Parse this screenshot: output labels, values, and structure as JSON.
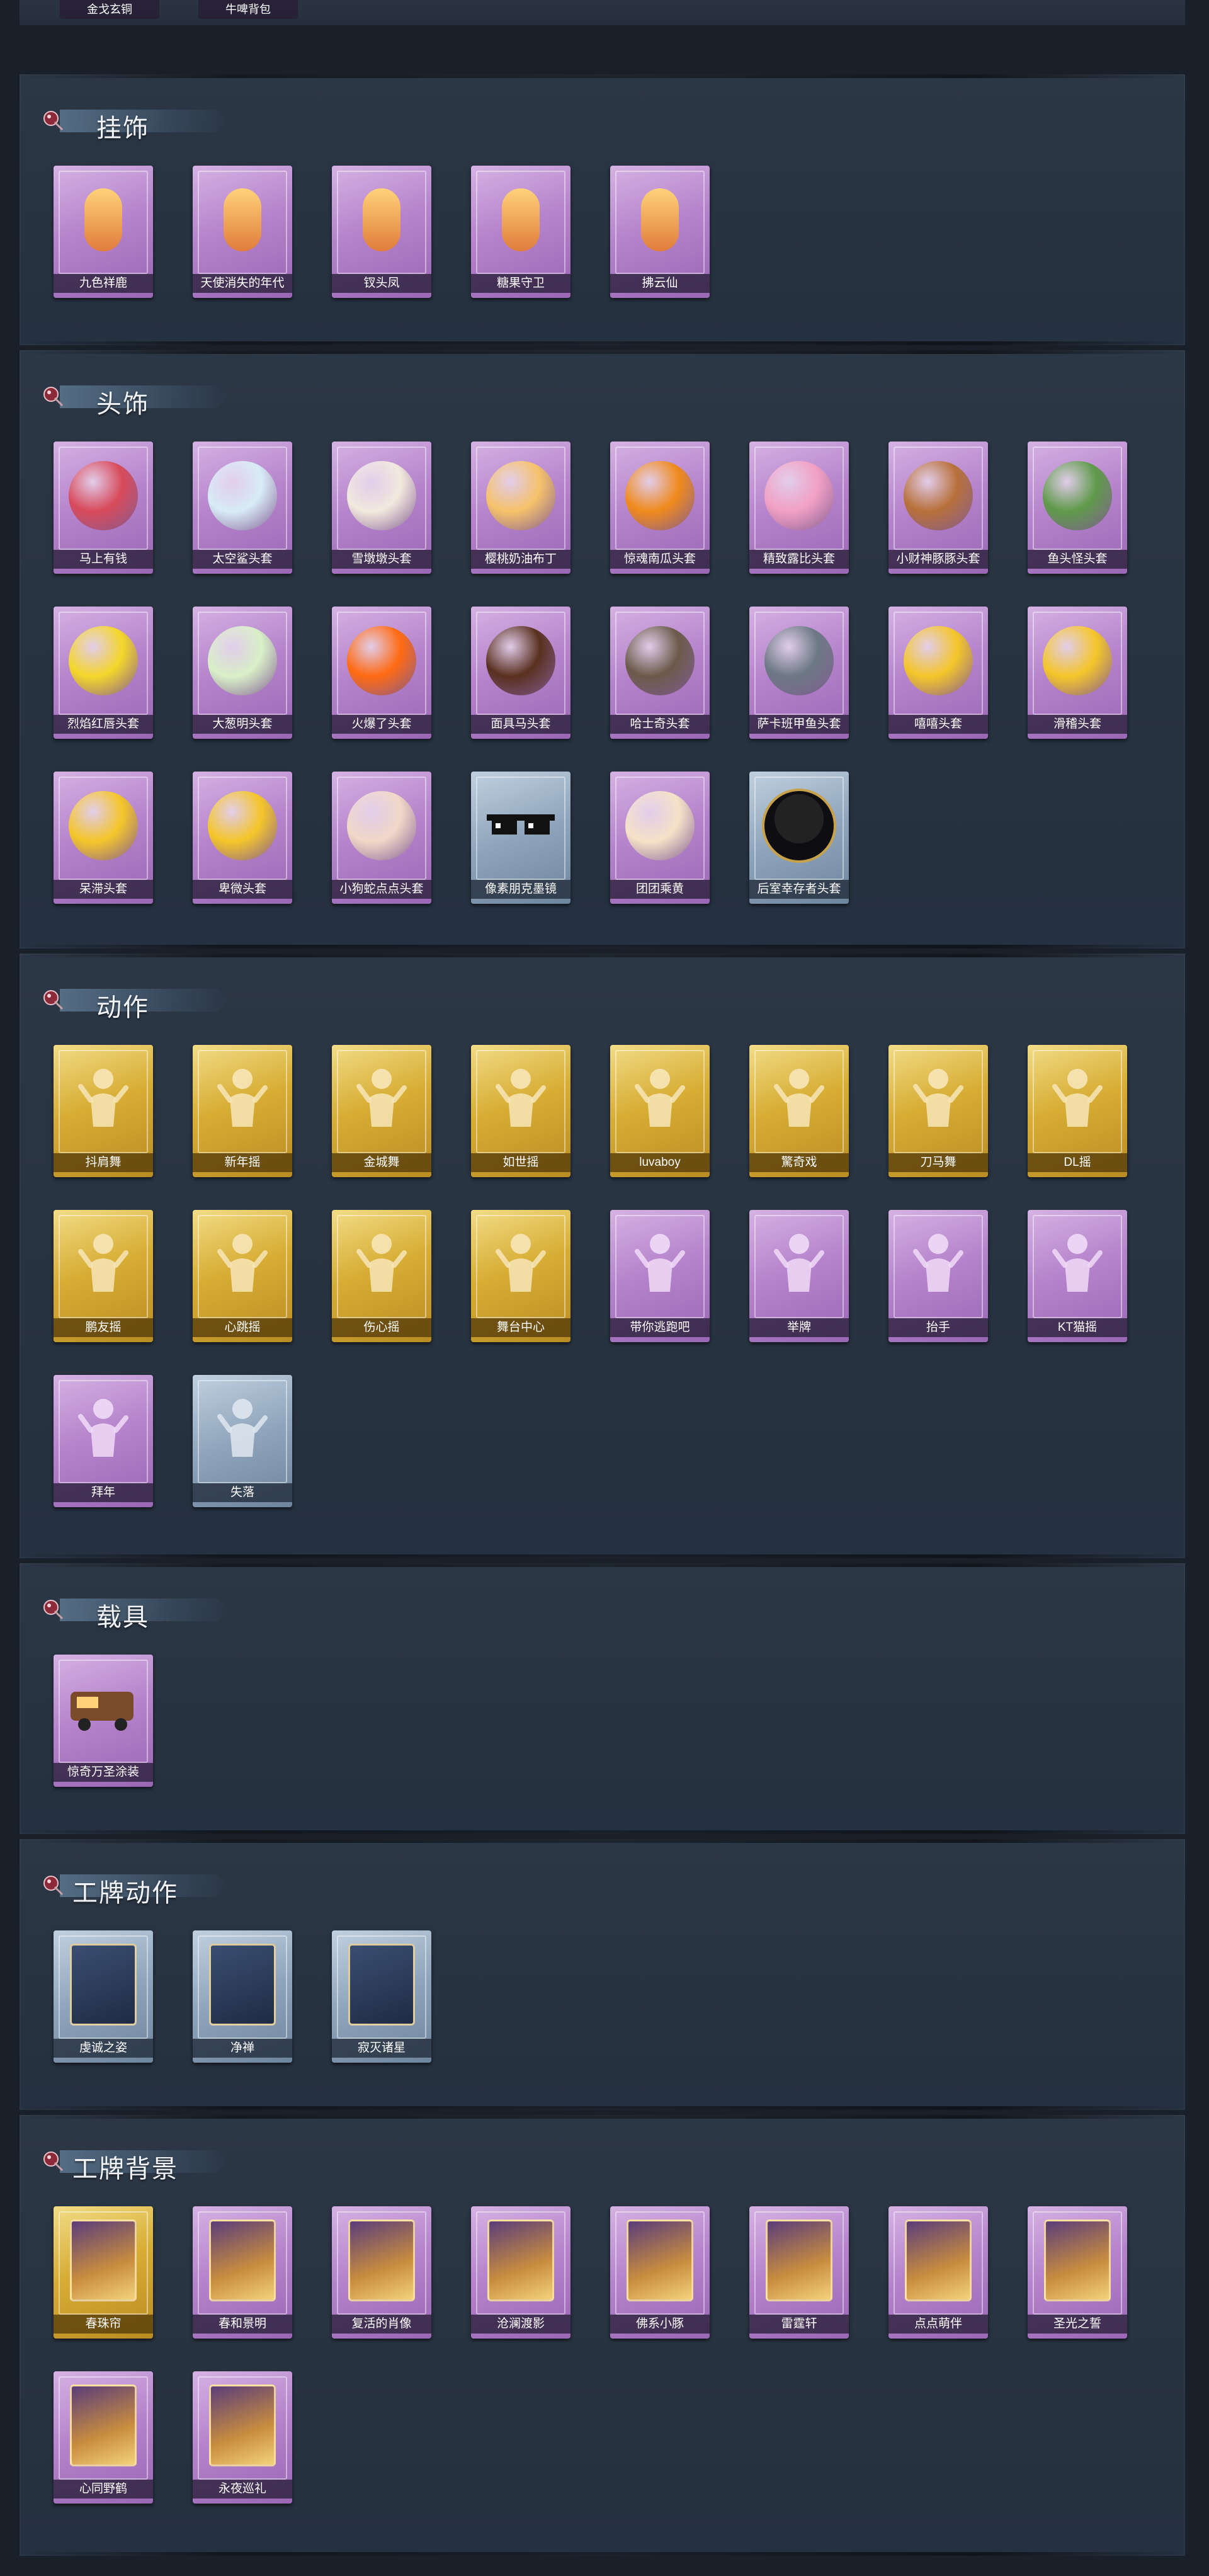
{
  "top": {
    "items": [
      "金戈玄铜",
      "牛啤背包"
    ]
  },
  "sections": [
    {
      "title": "挂饰",
      "items": [
        {
          "label": "九色祥鹿",
          "color": "purple",
          "icon": "pendant-deer-icon"
        },
        {
          "label": "天使消失的年代",
          "color": "purple",
          "icon": "pendant-angel-icon"
        },
        {
          "label": "钗头凤",
          "color": "purple",
          "icon": "pendant-phoenix-icon"
        },
        {
          "label": "糖果守卫",
          "color": "purple",
          "icon": "pendant-candy-icon"
        },
        {
          "label": "拂云仙",
          "color": "purple",
          "icon": "pendant-cloud-icon"
        }
      ]
    },
    {
      "title": "头饰",
      "items": [
        {
          "label": "马上有钱",
          "color": "purple",
          "icon": "horse-head-icon"
        },
        {
          "label": "太空鲨头套",
          "color": "purple",
          "icon": "shark-head-icon"
        },
        {
          "label": "雪墩墩头套",
          "color": "purple",
          "icon": "snow-dumpling-icon"
        },
        {
          "label": "樱桃奶油布丁",
          "color": "purple",
          "icon": "pudding-icon"
        },
        {
          "label": "惊魂南瓜头套",
          "color": "purple",
          "icon": "pumpkin-icon"
        },
        {
          "label": "精致露比头套",
          "color": "purple",
          "icon": "pink-creature-icon"
        },
        {
          "label": "小财神豚豚头套",
          "color": "purple",
          "icon": "piglet-icon"
        },
        {
          "label": "鱼头怪头套",
          "color": "purple",
          "icon": "fish-head-icon"
        },
        {
          "label": "烈焰红唇头套",
          "color": "purple",
          "icon": "pikachu-icon"
        },
        {
          "label": "大葱明头套",
          "color": "purple",
          "icon": "scallion-icon"
        },
        {
          "label": "火爆了头套",
          "color": "purple",
          "icon": "flame-icon"
        },
        {
          "label": "面具马头套",
          "color": "purple",
          "icon": "horse-mask-icon"
        },
        {
          "label": "哈士奇头套",
          "color": "purple",
          "icon": "husky-icon"
        },
        {
          "label": "萨卡班甲鱼头套",
          "color": "purple",
          "icon": "fish-icon"
        },
        {
          "label": "嘻嘻头套",
          "color": "purple",
          "icon": "grin-emoji-icon"
        },
        {
          "label": "滑稽头套",
          "color": "purple",
          "icon": "smirk-emoji-icon"
        },
        {
          "label": "呆滞头套",
          "color": "purple",
          "icon": "dazed-emoji-icon"
        },
        {
          "label": "卑微头套",
          "color": "purple",
          "icon": "humble-emoji-icon"
        },
        {
          "label": "小狗蛇点点头套",
          "color": "purple",
          "icon": "snake-icon"
        },
        {
          "label": "像素朋克墨镜",
          "color": "blue",
          "icon": "pixel-sunglasses-icon"
        },
        {
          "label": "团团乘黄",
          "color": "purple",
          "icon": "cat-icon"
        },
        {
          "label": "后室幸存者头套",
          "color": "blue",
          "icon": "gas-mask-icon"
        }
      ]
    },
    {
      "title": "动作",
      "items": [
        {
          "label": "抖肩舞",
          "color": "gold",
          "icon": "dance-figure-icon"
        },
        {
          "label": "新年摇",
          "color": "gold",
          "icon": "dance-figure-icon"
        },
        {
          "label": "金城舞",
          "color": "gold",
          "icon": "dance-figure-icon"
        },
        {
          "label": "如世摇",
          "color": "gold",
          "icon": "dance-figure-icon"
        },
        {
          "label": "luvaboy",
          "color": "gold",
          "icon": "dance-figure-icon"
        },
        {
          "label": "驚奇戏",
          "color": "gold",
          "icon": "dance-figure-icon"
        },
        {
          "label": "刀马舞",
          "color": "gold",
          "icon": "dance-figure-icon"
        },
        {
          "label": "DL摇",
          "color": "gold",
          "icon": "dance-figure-icon"
        },
        {
          "label": "鹏友摇",
          "color": "gold",
          "icon": "dance-figure-icon"
        },
        {
          "label": "心跳摇",
          "color": "gold",
          "icon": "dance-figure-icon"
        },
        {
          "label": "伤心摇",
          "color": "gold",
          "icon": "dance-figure-icon"
        },
        {
          "label": "舞台中心",
          "color": "gold",
          "icon": "dance-figure-icon"
        },
        {
          "label": "带你逃跑吧",
          "color": "purple",
          "icon": "dance-figure-icon"
        },
        {
          "label": "举牌",
          "color": "purple",
          "icon": "sign-figure-icon"
        },
        {
          "label": "抬手",
          "color": "purple",
          "icon": "raise-hand-icon"
        },
        {
          "label": "KT猫摇",
          "color": "purple",
          "icon": "dance-figure-icon"
        },
        {
          "label": "拜年",
          "color": "purple",
          "icon": "bow-figure-icon"
        },
        {
          "label": "失落",
          "color": "blue",
          "icon": "crawl-figure-icon"
        }
      ]
    },
    {
      "title": "载具",
      "items": [
        {
          "label": "惊奇万圣涂装",
          "color": "purple",
          "icon": "vehicle-icon"
        }
      ]
    },
    {
      "title": "工牌动作",
      "items": [
        {
          "label": "虔诚之姿",
          "color": "blue",
          "icon": "badge-pose-icon"
        },
        {
          "label": "净禅",
          "color": "blue",
          "icon": "badge-pose-icon"
        },
        {
          "label": "寂灭诸星",
          "color": "blue",
          "icon": "badge-pose-icon"
        }
      ]
    },
    {
      "title": "工牌背景",
      "items": [
        {
          "label": "春珠帘",
          "color": "gold",
          "icon": "card-bg-icon"
        },
        {
          "label": "春和景明",
          "color": "purple",
          "icon": "card-bg-icon"
        },
        {
          "label": "复活的肖像",
          "color": "purple",
          "icon": "card-bg-icon"
        },
        {
          "label": "沧澜渡影",
          "color": "purple",
          "icon": "card-bg-icon"
        },
        {
          "label": "佛系小豚",
          "color": "purple",
          "icon": "card-bg-icon"
        },
        {
          "label": "雷霆轩",
          "color": "purple",
          "icon": "card-bg-icon"
        },
        {
          "label": "点点萌伴",
          "color": "purple",
          "icon": "card-bg-icon"
        },
        {
          "label": "圣光之誓",
          "color": "purple",
          "icon": "card-bg-icon"
        },
        {
          "label": "心同野鹤",
          "color": "purple",
          "icon": "card-bg-icon"
        },
        {
          "label": "永夜巡礼",
          "color": "purple",
          "icon": "card-bg-icon"
        }
      ]
    }
  ],
  "colors": {
    "purple": "#b684cc",
    "gold": "#d7ad34",
    "blue": "#8ea4bb",
    "panel": "#2a3543",
    "background": "#1a202a"
  }
}
